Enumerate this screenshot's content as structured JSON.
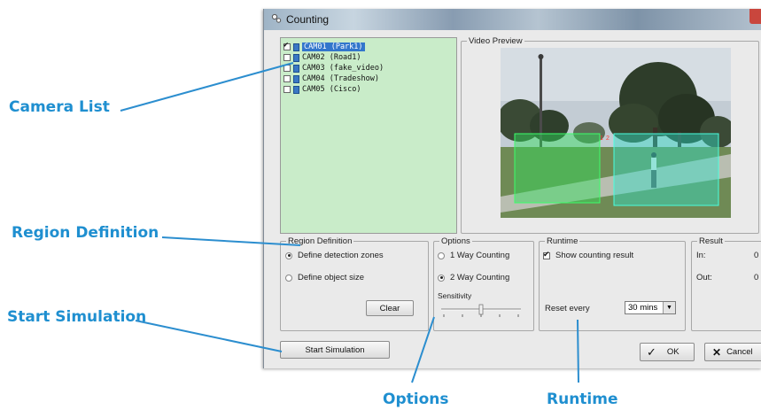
{
  "callouts": {
    "camera_list": "Camera List",
    "region_definition": "Region Definition",
    "start_simulation": "Start Simulation",
    "options": "Options",
    "runtime": "Runtime"
  },
  "window": {
    "title": "Counting"
  },
  "camera_list": [
    {
      "label": "CAM01 (Park1)",
      "checked": true,
      "selected": true
    },
    {
      "label": "CAM02 (Road1)",
      "checked": false,
      "selected": false
    },
    {
      "label": "CAM03 (fake_video)",
      "checked": false,
      "selected": false
    },
    {
      "label": "CAM04 (Tradeshow)",
      "checked": false,
      "selected": false
    },
    {
      "label": "CAM05 (Cisco)",
      "checked": false,
      "selected": false
    }
  ],
  "video_preview": {
    "title": "Video Preview",
    "zone_labels": [
      "1",
      "2"
    ]
  },
  "region_definition": {
    "title": "Region Definition",
    "define_zones": "Define detection zones",
    "define_size": "Define object size",
    "clear": "Clear",
    "selected": "zones"
  },
  "options": {
    "title": "Options",
    "one_way": "1 Way Counting",
    "two_way": "2 Way Counting",
    "sensitivity": "Sensitivity",
    "selected": "two_way"
  },
  "runtime": {
    "title": "Runtime",
    "show_result": "Show counting result",
    "show_result_checked": true,
    "reset_every": "Reset every",
    "reset_value": "30 mins"
  },
  "result": {
    "title": "Result",
    "in_label": "In:",
    "in_value": "0",
    "out_label": "Out:",
    "out_value": "0"
  },
  "buttons": {
    "start_simulation": "Start Simulation",
    "ok": "OK",
    "cancel": "Cancel"
  },
  "colors": {
    "callout": "#1f8fd0",
    "selection": "#3276cc",
    "camera_panel_bg": "#c9ecc9"
  }
}
